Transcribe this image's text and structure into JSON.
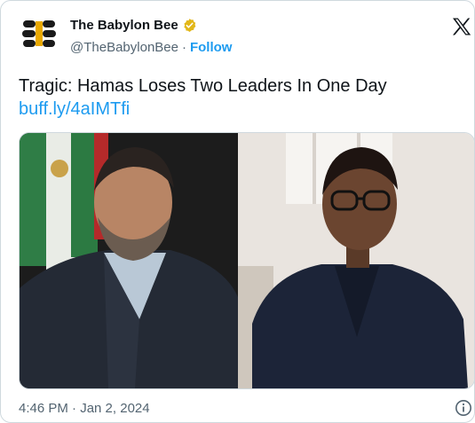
{
  "author": {
    "display_name": "The Babylon Bee",
    "handle": "@TheBabylonBee",
    "separator": "·",
    "follow_label": "Follow"
  },
  "tweet": {
    "text": "Tragic: Hamas Loses Two Leaders In One Day",
    "link": "buff.ly/4aIMTfi",
    "timestamp": "4:46 PM · Jan 2, 2024"
  },
  "colors": {
    "accent": "#1d9bf0",
    "verified_badge": "#e2b719",
    "text_primary": "#0f1419",
    "text_secondary": "#536471"
  },
  "icons": {
    "verified": "verified-gold-badge-icon",
    "platform": "x-logo-icon",
    "info": "info-icon"
  }
}
